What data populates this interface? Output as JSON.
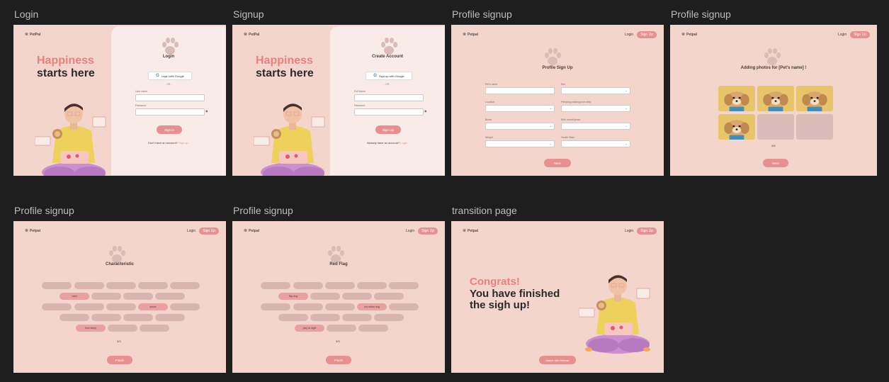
{
  "frames": {
    "login": "Login",
    "signup": "Signup",
    "profile1": "Profile signup",
    "profile2": "Profile signup",
    "profile3": "Profile signup",
    "profile4": "Profile signup",
    "transition": "transition page"
  },
  "brand": {
    "name": "PetPal",
    "name_alt": "Petpal"
  },
  "nav": {
    "login": "Login",
    "signup": "Sign Up"
  },
  "hero": {
    "line1": "Happiness",
    "line2": "starts here"
  },
  "login": {
    "title": "Login",
    "google": "Login with Google",
    "or": "- OR -",
    "username_label": "User name",
    "password_label": "Password",
    "submit": "Sign in",
    "footer_text": "Don't have an account?",
    "footer_link": "Sign up"
  },
  "signup": {
    "title": "Create Account",
    "google": "Sign up with Google",
    "or": "- OR -",
    "fullname_label": "Full Name",
    "password_label": "Password",
    "submit": "Sign Up",
    "footer_text": "Already have an account?",
    "footer_link": "Login"
  },
  "profile": {
    "title": "Profile Sign Up",
    "fields_left": [
      "Pet's name",
      "Location",
      "Breed",
      "Weight"
    ],
    "fields_right": [
      "Sex",
      "Pets(dog,walking,love,kids)",
      "Birth month/years",
      "Health State"
    ],
    "next": "Next"
  },
  "photos": {
    "title": "Adding photos for [Pet's name] !",
    "count": "4/6",
    "next": "Next"
  },
  "characteristic": {
    "title": "Characteristic",
    "tags": [
      "calm",
      "active",
      "love sleep"
    ],
    "count": "3/3",
    "finish": "Finish"
  },
  "redflag": {
    "title": "Red Flag",
    "tags": [
      "Big dog",
      "not active dog",
      "play at night"
    ],
    "count": "3/3",
    "finish": "Finish"
  },
  "transition": {
    "line1": "Congrats!",
    "line2": "You have finished",
    "line3": "the sigh up!",
    "button": "Match with friends!"
  }
}
